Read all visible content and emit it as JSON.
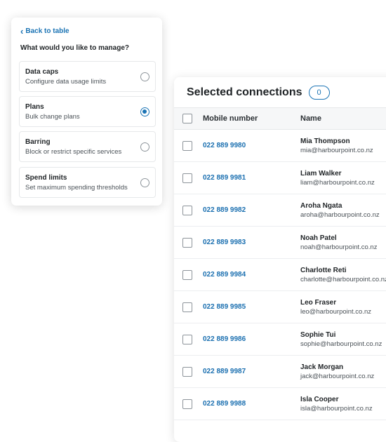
{
  "manage": {
    "back_label": "Back to table",
    "question": "What would you like to manage?",
    "options": [
      {
        "title": "Data caps",
        "description": "Configure data usage limits",
        "selected": false
      },
      {
        "title": "Plans",
        "description": "Bulk change plans",
        "selected": true
      },
      {
        "title": "Barring",
        "description": "Block or restrict specific services",
        "selected": false
      },
      {
        "title": "Spend limits",
        "description": "Set maximum spending thresholds",
        "selected": false
      }
    ]
  },
  "connections": {
    "title": "Selected connections",
    "count": "0",
    "columns": {
      "number": "Mobile number",
      "name": "Name"
    },
    "rows": [
      {
        "number": "022 889 9980",
        "name": "Mia Thompson",
        "email": "mia@harbourpoint.co.nz"
      },
      {
        "number": "022 889 9981",
        "name": "Liam Walker",
        "email": "liam@harbourpoint.co.nz"
      },
      {
        "number": "022 889 9982",
        "name": "Aroha Ngata",
        "email": "aroha@harbourpoint.co.nz"
      },
      {
        "number": "022 889 9983",
        "name": "Noah Patel",
        "email": "noah@harbourpoint.co.nz"
      },
      {
        "number": "022 889 9984",
        "name": "Charlotte Reti",
        "email": "charlotte@harbourpoint.co.nz"
      },
      {
        "number": "022 889 9985",
        "name": "Leo Fraser",
        "email": "leo@harbourpoint.co.nz"
      },
      {
        "number": "022 889 9986",
        "name": "Sophie Tui",
        "email": "sophie@harbourpoint.co.nz"
      },
      {
        "number": "022 889 9987",
        "name": "Jack Morgan",
        "email": "jack@harbourpoint.co.nz"
      },
      {
        "number": "022 889 9988",
        "name": "Isla Cooper",
        "email": "isla@harbourpoint.co.nz"
      }
    ]
  },
  "colors": {
    "accent": "#1a73b4",
    "link_number": "#1a6fb0",
    "text": "#1f2326"
  }
}
